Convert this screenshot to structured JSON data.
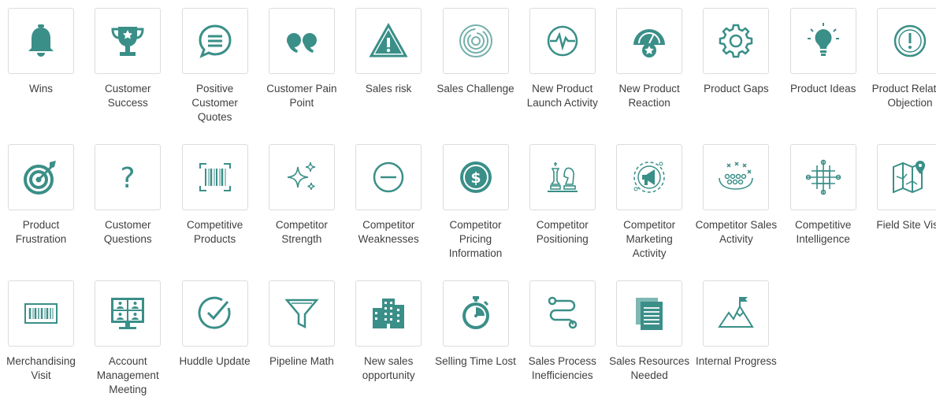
{
  "theme": {
    "accent": "#3a8f88",
    "border": "#dcdcdc",
    "text": "#3f3f3f"
  },
  "rows": [
    [
      {
        "label": "Wins",
        "icon": "bell-icon"
      },
      {
        "label": "Customer Success",
        "icon": "trophy-icon"
      },
      {
        "label": "Positive Customer Quotes",
        "icon": "speech-bubble-icon"
      },
      {
        "label": "Customer Pain Point",
        "icon": "quote-marks-icon"
      },
      {
        "label": "Sales risk",
        "icon": "warning-icon"
      },
      {
        "label": "Sales Challenge",
        "icon": "maze-icon"
      },
      {
        "label": "New Product Launch Activity",
        "icon": "pulse-icon"
      },
      {
        "label": "New Product Reaction",
        "icon": "gauge-star-icon"
      },
      {
        "label": "Product Gaps",
        "icon": "gear-icon"
      },
      {
        "label": "Product Ideas",
        "icon": "lightbulb-icon"
      },
      {
        "label": "Product Related Objection",
        "icon": "exclamation-circle-icon"
      }
    ],
    [
      {
        "label": "Product Frustration",
        "icon": "target-icon"
      },
      {
        "label": "Customer Questions",
        "icon": "question-mark-icon"
      },
      {
        "label": "Competitive Products",
        "icon": "barcode-scan-icon"
      },
      {
        "label": "Competitor Strength",
        "icon": "sparkles-icon"
      },
      {
        "label": "Competitor Weaknesses",
        "icon": "minus-circle-icon"
      },
      {
        "label": "Competitor Pricing Information",
        "icon": "dollar-coin-icon"
      },
      {
        "label": "Competitor Positioning",
        "icon": "chess-icon"
      },
      {
        "label": "Competitor Marketing Activity",
        "icon": "megaphone-icon"
      },
      {
        "label": "Competitor Sales Activity",
        "icon": "play-diagram-icon"
      },
      {
        "label": "Competitive Intelligence",
        "icon": "network-icon"
      },
      {
        "label": "Field Site Visit",
        "icon": "map-pin-icon"
      }
    ],
    [
      {
        "label": "Merchandising Visit",
        "icon": "barcode-icon"
      },
      {
        "label": "Account Management Meeting",
        "icon": "video-meeting-icon"
      },
      {
        "label": "Huddle Update",
        "icon": "check-circle-icon"
      },
      {
        "label": "Pipeline Math",
        "icon": "funnel-icon"
      },
      {
        "label": "New sales opportunity",
        "icon": "building-icon"
      },
      {
        "label": "Selling Time Lost",
        "icon": "stopwatch-icon"
      },
      {
        "label": "Sales Process Inefficiencies",
        "icon": "process-path-icon"
      },
      {
        "label": "Sales Resources Needed",
        "icon": "documents-icon"
      },
      {
        "label": "Internal Progress",
        "icon": "mountain-flag-icon"
      }
    ]
  ]
}
